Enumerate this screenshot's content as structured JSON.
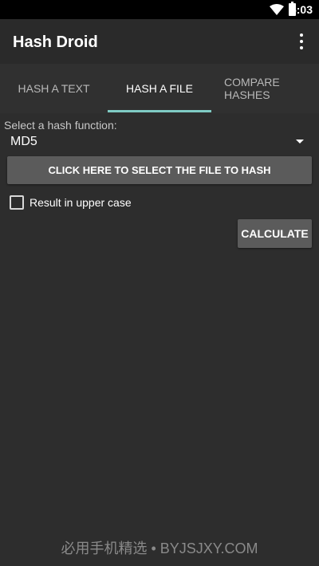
{
  "status_bar": {
    "time": "5:03",
    "icons": [
      "wifi-icon",
      "battery-icon"
    ]
  },
  "app_bar": {
    "title": "Hash Droid",
    "menu_icon": "more-vert-icon"
  },
  "tabs": [
    {
      "label": "HASH A TEXT",
      "active": false
    },
    {
      "label": "HASH A FILE",
      "active": true
    },
    {
      "label": "COMPARE HASHES",
      "active": false
    }
  ],
  "colors": {
    "accent": "#7fcbc4",
    "background": "#2d2d2d",
    "button": "#5b5b5b"
  },
  "hash_function": {
    "label": "Select a hash function:",
    "selected": "MD5"
  },
  "file_button_label": "CLICK HERE TO SELECT THE FILE TO HASH",
  "uppercase_option": {
    "label": "Result in upper case",
    "checked": false
  },
  "calculate_label": "CALCULATE",
  "watermark": "必用手机精选 • BYJSJXY.COM"
}
